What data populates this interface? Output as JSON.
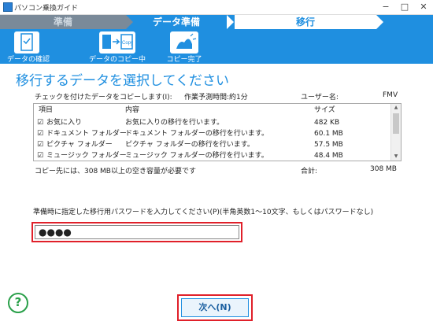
{
  "window": {
    "title": "パソコン乗換ガイド"
  },
  "steps": [
    "準備",
    "データ準備",
    "移行"
  ],
  "substeps": [
    "データの確認",
    "データのコピー中",
    "コピー完了"
  ],
  "heading": "移行するデータを選択してください",
  "info": {
    "instruction": "チェックを付けたデータをコピーします(I):",
    "estimate": "作業予測時間:約1分",
    "user_label": "ユーザー名:",
    "user_value": "FMV"
  },
  "table": {
    "headers": [
      "項目",
      "内容",
      "サイズ"
    ],
    "rows": [
      {
        "item": "お気に入り",
        "desc": "お気に入りの移行を行います。",
        "size": "482 KB"
      },
      {
        "item": "ドキュメント フォルダー",
        "desc": "ドキュメント フォルダーの移行を行います。",
        "size": "60.1 MB"
      },
      {
        "item": "ピクチャ フォルダー",
        "desc": "ピクチャ フォルダーの移行を行います。",
        "size": "57.5 MB"
      },
      {
        "item": "ミュージック フォルダー",
        "desc": "ミュージック フォルダーの移行を行います。",
        "size": "48.4 MB"
      }
    ]
  },
  "capacity": {
    "note": "コピー先には、308 MB以上の空き容量が必要です",
    "total_label": "合計:",
    "total_value": "308 MB"
  },
  "password": {
    "label": "準備時に指定した移行用パスワードを入力してください(P)(半角英数1〜10文字、もしくはパスワードなし)",
    "value": "●●●●"
  },
  "buttons": {
    "next": "次へ(N)",
    "help": "?"
  },
  "colors": {
    "accent": "#1f8fe0",
    "highlight": "#e0202a",
    "help": "#2aa04a"
  }
}
